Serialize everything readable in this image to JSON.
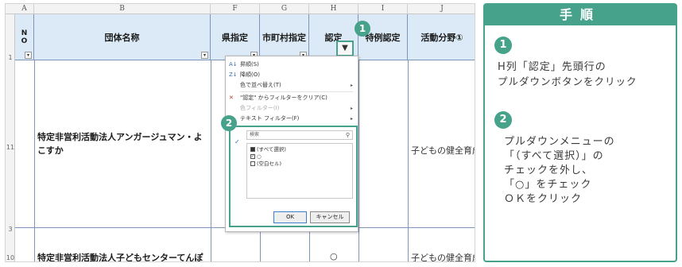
{
  "columns": [
    "A",
    "B",
    "F",
    "G",
    "H",
    "I",
    "J"
  ],
  "headers": {
    "no_n": "N",
    "no_o": "O",
    "group_name": "団体名称",
    "prefecture": "県指定",
    "municipality": "市町村指定",
    "certified": "認定",
    "special": "特例認定",
    "activity": "活動分野①"
  },
  "rows": {
    "header_row_num": "1",
    "row11_num": "11",
    "row11_name": "特定非営利活動法人アンガージュマン・よこすか",
    "row11_activity": "子どもの健全育成",
    "row3_num": "3",
    "row10_num": "10",
    "row10_name": "特定非営利活動法人子どもセンターてんぽ",
    "row10_certified": "○",
    "row10_activity": "子どもの健全育成"
  },
  "filter_menu": {
    "sort_asc": "昇順(S)",
    "sort_desc": "降順(O)",
    "sort_color": "色で並べ替え(T)",
    "clear_filter": "\"認定\" からフィルターをクリア(C)",
    "color_filter": "色フィルター(I)",
    "text_filter": "テキスト フィルター(F)",
    "search_placeholder": "検索",
    "items": [
      "(すべて選択)",
      "○",
      "(空白セル)"
    ],
    "ok": "OK",
    "cancel": "キャンセル"
  },
  "badges": {
    "one": "1",
    "two": "2"
  },
  "instructions": {
    "title": "手順",
    "step1_badge": "1",
    "step1_line1": "H列「認定」先頭行の",
    "step1_line2": "プルダウンボタンをクリック",
    "step2_badge": "2",
    "step2_line1": "プルダウンメニューの",
    "step2_line2": "「（すべて選択）」の",
    "step2_line3": "チェックを外し、",
    "step2_line4": "「○」をチェック",
    "step2_line5": "ＯＫをクリック"
  },
  "colors": {
    "accent": "#46a28a",
    "header_fill": "#dbeaf6"
  }
}
